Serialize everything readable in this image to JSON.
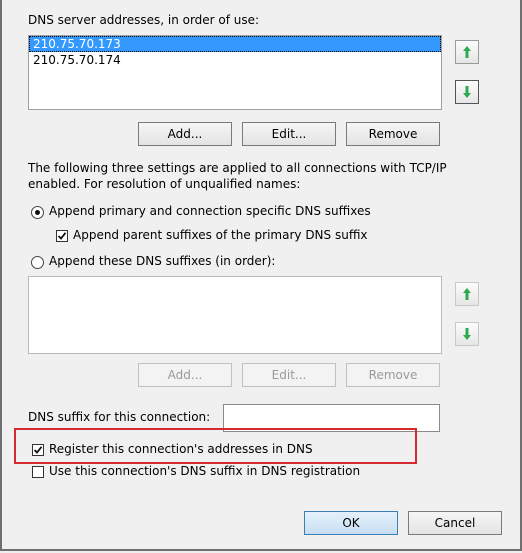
{
  "dns_servers": {
    "label": "DNS server addresses, in order of use:",
    "addresses": [
      "210.75.70.173",
      "210.75.70.174"
    ],
    "selected_index": 0,
    "buttons": {
      "add": "Add...",
      "edit": "Edit...",
      "remove": "Remove"
    }
  },
  "resolution": {
    "description_line1": "The following three settings are applied to all connections with TCP/IP",
    "description_line2": "enabled. For resolution of unqualified names:",
    "option_primary_label": "Append primary and connection specific DNS suffixes",
    "option_primary_selected": true,
    "parent_suffix_label": "Append parent suffixes of the primary DNS suffix",
    "parent_suffix_checked": true,
    "option_these_label": "Append these DNS suffixes (in order):",
    "option_these_selected": false,
    "suffix_buttons": {
      "add": "Add...",
      "edit": "Edit...",
      "remove": "Remove"
    }
  },
  "connection_suffix": {
    "label": "DNS suffix for this connection:",
    "value": ""
  },
  "registration": {
    "register_label": "Register this connection's addresses in DNS",
    "register_checked": true,
    "use_suffix_label": "Use this connection's DNS suffix in DNS registration",
    "use_suffix_checked": false
  },
  "footer": {
    "ok": "OK",
    "cancel": "Cancel"
  },
  "colors": {
    "highlight": "#d32a30",
    "arrow_green": "#2fa84f",
    "selection": "#3399ff"
  }
}
